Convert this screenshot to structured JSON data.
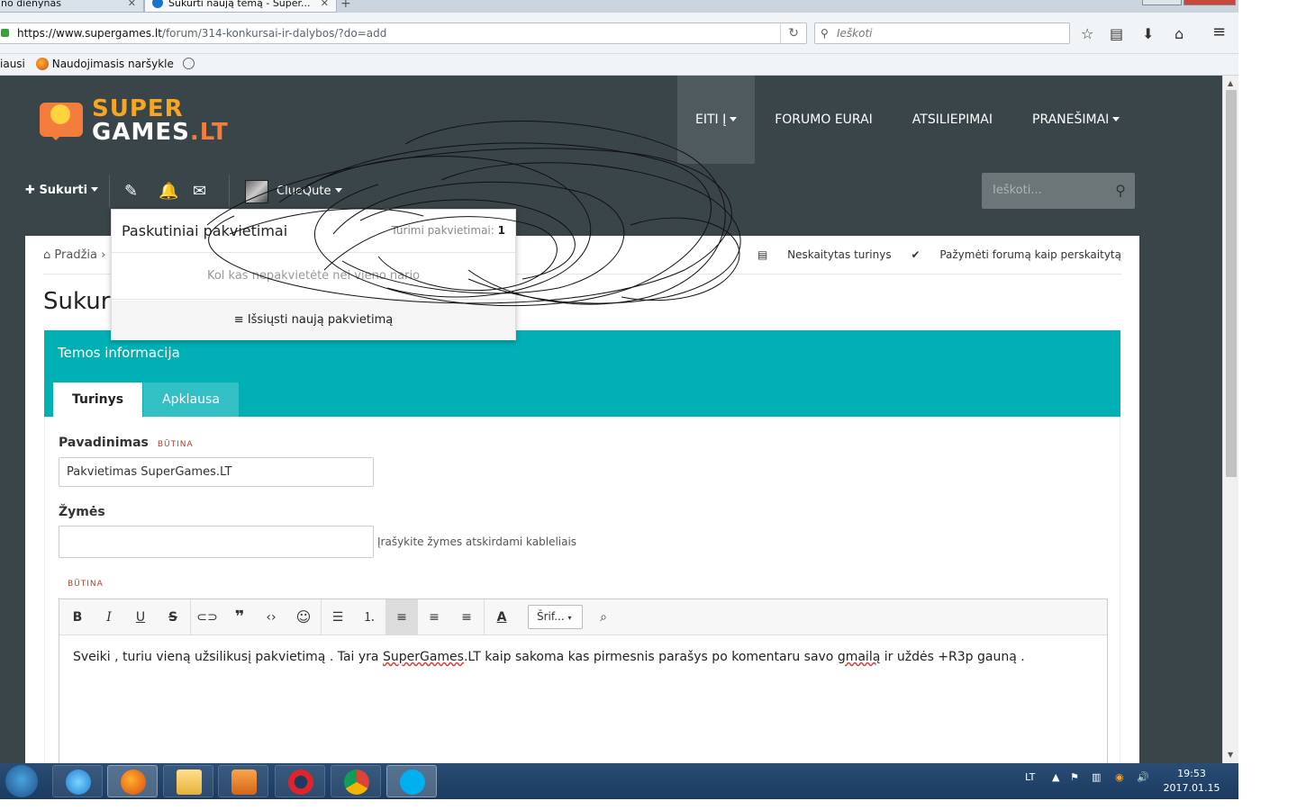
{
  "browser": {
    "tabs": [
      {
        "label": "no dienynas",
        "active": false
      },
      {
        "label": "Sukurti naują temą - Super...",
        "active": true
      }
    ],
    "url_host": "https://www.supergames.lt",
    "url_path": "/forum/314-konkursai-ir-dalybos/?do=add",
    "search_placeholder": "Ieškoti",
    "bookmarks": [
      "iausi",
      "Naudojimasis naršykle"
    ]
  },
  "site": {
    "logo_line1": "SUPER",
    "logo_line2_a": "GAMES",
    "logo_line2_b": ".LT",
    "nav": [
      {
        "label": "EITI Į",
        "dropdown": true,
        "active": true
      },
      {
        "label": "FORUMO EURAI",
        "dropdown": false,
        "active": false
      },
      {
        "label": "ATSILIEPIMAI",
        "dropdown": false,
        "active": false
      },
      {
        "label": "PRANEŠIMAI",
        "dropdown": true,
        "active": false
      }
    ],
    "create_label": "Sukurti",
    "username": "ClueQute",
    "search_placeholder": "Ieškoti..."
  },
  "breadcrumb": {
    "home": "Pradžia"
  },
  "actions": {
    "unread": "Neskaitytas turinys",
    "mark_read": "Pažymėti forumą kaip perskaitytą"
  },
  "page_title": "Sukurti naują temą",
  "section": {
    "title": "Temos informacija",
    "tabs": [
      "Turinys",
      "Apklausa"
    ]
  },
  "form": {
    "title_label": "Pavadinimas",
    "required": "BŪTINA",
    "title_value": "Pakvietimas SuperGames.LT",
    "tags_label": "Žymės",
    "tags_value": "",
    "tags_hint": "Įrašykite žymes atskirdami kableliais",
    "body_required": "BŪTINA",
    "font_select": "Šrif...",
    "body_text_parts": [
      "Sveiki , turiu vieną užsilikusį pakvietimą . Tai yra ",
      "SuperGames",
      ".LT kaip sakoma kas pirmesnis parašys po komentaru savo ",
      "gmailą",
      " ir uždės +R3p gauną ."
    ]
  },
  "dropdown": {
    "title": "Paskutiniai pakvietimai",
    "count_label": "Turimi pakvietimai:",
    "count_value": "1",
    "empty": "Kol kas nepakvietėte nei vieno nario",
    "footer": "Išsiųsti naują pakvietimą"
  },
  "taskbar": {
    "language": "LT",
    "time": "19:53",
    "date": "2017.01.15"
  }
}
